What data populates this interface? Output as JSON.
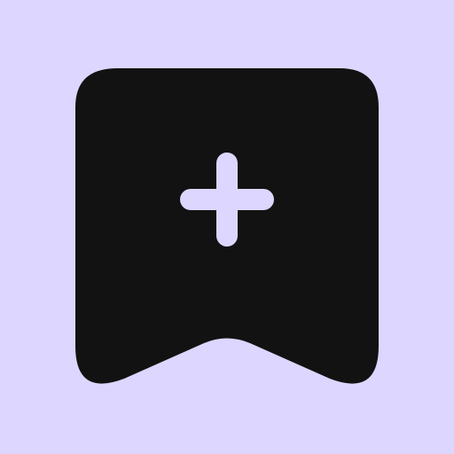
{
  "icon": {
    "name": "bookmark-add-icon",
    "background_color": "#DDD6FE",
    "shape_color": "#121212",
    "plus_color": "#DDD6FE"
  }
}
